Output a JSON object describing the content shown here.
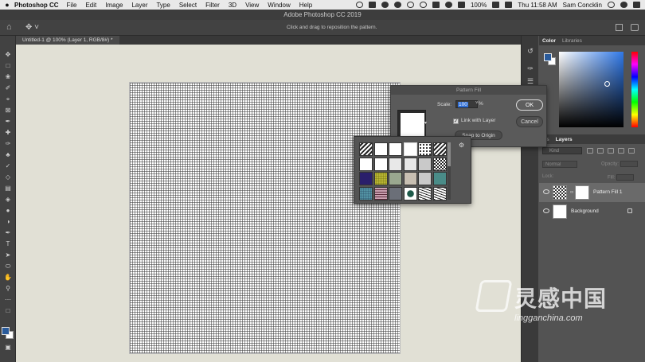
{
  "menubar": {
    "apple": "",
    "app_name": "Photoshop CC",
    "items": [
      "File",
      "Edit",
      "Image",
      "Layer",
      "Type",
      "Select",
      "Filter",
      "3D",
      "View",
      "Window",
      "Help"
    ],
    "battery": "100%",
    "clock": "Thu 11:58 AM",
    "user": "Sam Concklin"
  },
  "window": {
    "title": "Adobe Photoshop CC 2019"
  },
  "options_bar": {
    "hint": "Click and drag to reposition the pattern."
  },
  "document": {
    "tab_label": "Untitled-1 @ 100% (Layer 1, RGB/8#) *"
  },
  "panels": {
    "color_tab": "Color",
    "libraries_tab": "Libraries",
    "paths_tab": "ths",
    "layers_tab": "Layers",
    "search_kind": "Kind",
    "blend_mode": "Normal",
    "opacity_label": "Opacity:",
    "lock_label": "Lock:",
    "fill_label": "Fill:",
    "colors": {
      "foreground": "#2a5b9b",
      "background": "#ffffff"
    }
  },
  "layers": [
    {
      "name": "Pattern Fill 1",
      "selected": true
    },
    {
      "name": "Background",
      "locked": true
    }
  ],
  "pattern_fill_dialog": {
    "title": "Pattern Fill",
    "scale_label": "Scale:",
    "scale_value": "100",
    "scale_unit": "%",
    "link_with_layer_label": "Link with Layer",
    "link_with_layer_checked": true,
    "snap_button": "Snap to Origin",
    "ok_button": "OK",
    "cancel_button": "Cancel"
  },
  "pattern_picker": {
    "patterns": [
      "p-diag",
      "p-white",
      "p-white",
      "p-white",
      "p-dots",
      "p-diag",
      "p-white",
      "p-white",
      "p-lgray",
      "p-lgray",
      "p-gray",
      "p-check",
      "p-navy",
      "p-olive",
      "p-sage",
      "p-beige",
      "p-gray",
      "p-teal",
      "p-tealdk",
      "p-maroon",
      "p-slate",
      "p-ring",
      "p-wave",
      "p-wave"
    ]
  },
  "watermark": {
    "chinese": "灵感中国",
    "english": "lingganchina.com"
  }
}
